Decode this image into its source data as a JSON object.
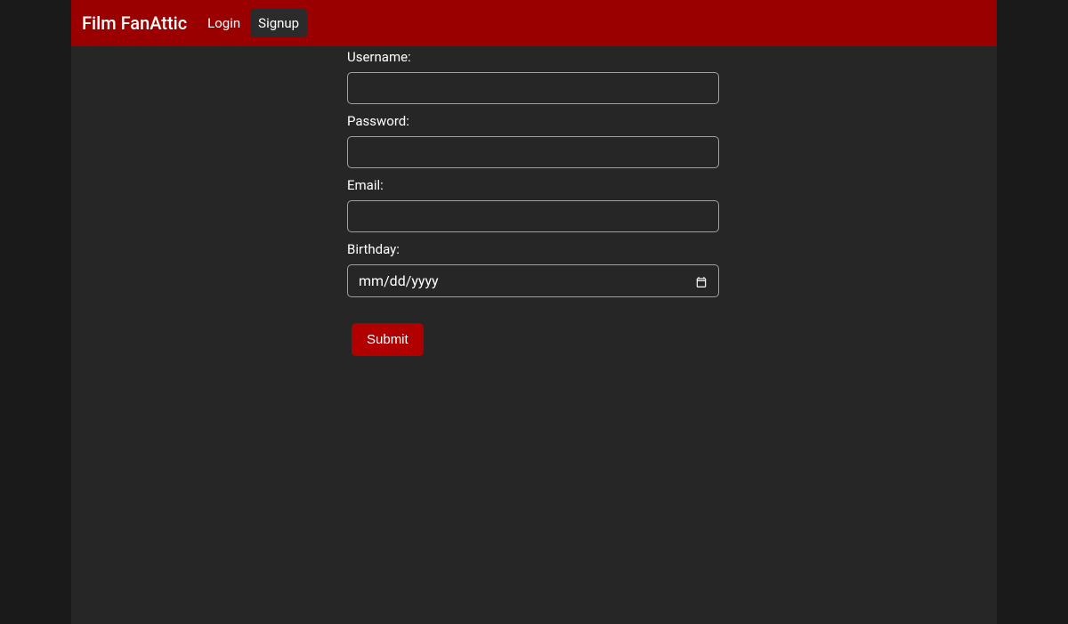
{
  "brand": "Film FanAttic",
  "nav": {
    "login": "Login",
    "signup": "Signup"
  },
  "form": {
    "username_label": "Username:",
    "username_value": "",
    "password_label": "Password:",
    "password_value": "",
    "email_label": "Email:",
    "email_value": "",
    "birthday_label": "Birthday:",
    "birthday_placeholder": "mm/dd/yyyy",
    "birthday_value": "",
    "submit_label": "Submit"
  }
}
